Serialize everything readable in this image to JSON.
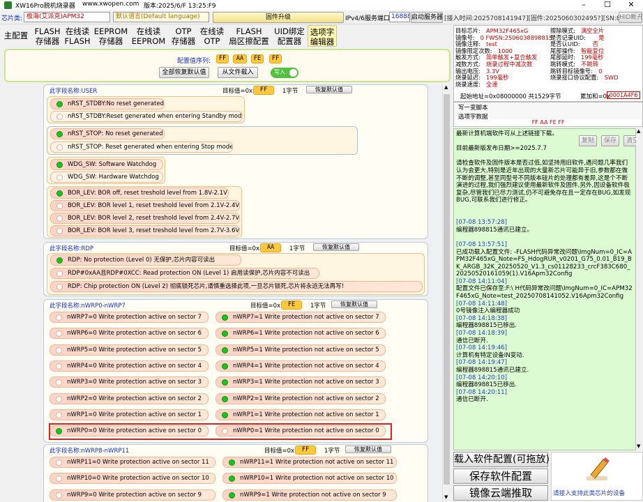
{
  "window": {
    "title": "XW16Pro脱机烧录器",
    "website": "www.xwopen.com",
    "version": "版本:2025/6/F 13:25:F9"
  },
  "topbar": {
    "chip_label": "芯片类:",
    "chip_value": "极海(艾派克)APM32",
    "lang_value": "默认语言(Default language)",
    "firmware_button": "固件升级",
    "port_label": "IPv4/6服务端口:",
    "port_value": "16888",
    "start_server": "启动服务器",
    "access_time": "[接入时间:2025708141947][固件:2025060302495?][SN:898815]",
    "hid_button": "HID断开"
  },
  "tabs": [
    {
      "l1": "主配置",
      "l2": ""
    },
    {
      "l1": "FLASH",
      "l2": "存储器"
    },
    {
      "l1": "在线读",
      "l2": "FLASH"
    },
    {
      "l1": "EEPROM",
      "l2": "存储器"
    },
    {
      "l1": "在线读",
      "l2": "EEPROM"
    },
    {
      "l1": "OTP",
      "l2": "存储器"
    },
    {
      "l1": "在线读",
      "l2": "OTP"
    },
    {
      "l1": "FLASH",
      "l2": "扇区擦配置"
    },
    {
      "l1": "UID绑定",
      "l2": "配置器"
    },
    {
      "l1": "选项字",
      "l2": "编辑器"
    }
  ],
  "config": {
    "seq_label": "配置值序列:",
    "seq_values": [
      "FF",
      "AA",
      "FE",
      "FF"
    ],
    "restore_all": "全部恢复默认值",
    "load_file": "从文件载入",
    "write_toggle": "写入"
  },
  "sections": {
    "user": {
      "name": "此字段名称:USER",
      "target_label": "目标值=0x",
      "target": "FF",
      "bytes": "1字节",
      "restore": "恢复默认值",
      "groups": [
        [
          "nRST_STDBY:No reset generated",
          "nRST_STDBY:Reset generated when entering Standby mode"
        ],
        [
          "nRST_STOP: No reset generated",
          "nRST_STOP: Reset generated when entering Stop mode"
        ],
        [
          "WDG_SW:   Software Watchdog",
          "WDG_SW:   Hardware Watchdog"
        ],
        [
          "BOR_LEV:   BOR off, reset treshold level from 1.8V-2.1V",
          "BOR_LEV:   BOR level 1, reset treshold level from 2.1V-2.4V",
          "BOR_LEV:   BOR level 2, reset treshold level from 2.4V-2.7V",
          "BOR_LEV:   BOR level 3, reset treshold level from 2.7V-3.6V"
        ]
      ]
    },
    "rdp": {
      "name": "此字段名称:RDP",
      "target_label": "目标值=0x",
      "target": "AA",
      "bytes": "1字节",
      "restore": "恢复默认值",
      "options": [
        "RDP:       No protection (Level 0)       无保护,芯片内容可读出",
        "RDP#0xAA且RDP#0XCC:   Read protection ON (Level 1)   启用读保护,芯片内容不可读出",
        "RDP:       Chip protection ON (Level 2)   彻底锁死芯片,请慎重选择此项,一旦芯片锁死,芯片将永远无法再写!"
      ]
    },
    "wrp0": {
      "name": "此字段名称:nWRP0-nWRP7",
      "target_label": "目标值=0x",
      "target": "FE",
      "bytes": "1字节",
      "restore": "恢复默认值",
      "left": [
        "nWRP7=0    Write protection active on sector  7",
        "nWRP6=0    Write protection active on sector  6",
        "nWRP5=0    Write protection active on sector  5",
        "nWRP4=0    Write protection active on sector  4",
        "nWRP3=0    Write protection active on sector  3",
        "nWRP2=0    Write protection active on sector  2",
        "nWRP1=0    Write protection active on sector  1",
        "nWRP0=0    Write protection active on sector  0"
      ],
      "right": [
        "nWRP7=1    Write protection not active on sector  7",
        "nWRP6=1    Write protection not active on sector  6",
        "nWRP5=1    Write protection not active on sector  5",
        "nWRP4=1    Write protection not active on sector  4",
        "nWRP3=1    Write protection not active on sector  3",
        "nWRP2=1    Write protection not active on sector  2",
        "nWRP1=1    Write protection not active on sector  1",
        "nWRP0=1    Write protection not active on sector  0"
      ]
    },
    "wrp8": {
      "name": "此字段名称:nWRP8-nWRP11",
      "target_label": "目标值=0x",
      "target": "FF",
      "bytes": "1字节",
      "restore": "恢复默认值",
      "left": [
        "nWRP11=0    Write protection active on sector  11",
        "nWRP10=0    Write protection active on sector  10",
        "nWRP9=0    Write protection active on sector  9"
      ],
      "right": [
        "nWRP11=1    Write protection not active on sector  11",
        "nWRP10=1    Write protection not active on sector  10",
        "nWRP9=1    Write protection not active on sector  9"
      ]
    }
  },
  "info": {
    "left": [
      [
        "目标芯片:",
        "APM32F465xG"
      ],
      [
        "镜像号:",
        "0 FWSN:2506038898815"
      ],
      [
        "镜像注释:",
        "test"
      ],
      [
        "镜像限定次数:",
        "1000"
      ],
      [
        "触发方式:",
        "简单触发+复合触发"
      ],
      [
        "减数方式:",
        "烧录过程中减次数"
      ],
      [
        "输出电压:",
        "3.3V"
      ],
      [
        "烧录延迟:",
        "199毫秒"
      ],
      [
        "烧录速度:",
        "全速"
      ]
    ],
    "right": [
      [
        "擦除模式:",
        "满空全片"
      ],
      [
        "是否记录UID:",
        "是"
      ],
      [
        "是否认UID:",
        "否"
      ],
      [
        "尾部操作:",
        "智能复位"
      ],
      [
        "尾部延时:",
        "199毫秒"
      ],
      [
        "跳转模式:",
        "不跳转"
      ],
      [
        "跳转目标镜像号:",
        "0"
      ],
      [
        "烧录接口协议配置:",
        "SWD"
      ]
    ],
    "addr_line": "起始地址=0x08000000  共1529字节",
    "sum_label": "累加和=0x",
    "sum_value": "0001A4F6"
  },
  "script": {
    "label": "写一变脚本",
    "option_label": "选项字数据",
    "option_value": "FF AA FE FF"
  },
  "log": {
    "buttons": [
      "复制",
      "保存",
      "清空"
    ],
    "lines": [
      {
        "t": "最新计算机端软件可从上述链接下载。",
        "ts": false
      },
      {
        "t": "",
        "ts": false
      },
      {
        "t": "目前最新版发布日期>=2025.7.7",
        "ts": false
      },
      {
        "t": "",
        "ts": false
      },
      {
        "t": "请检查软件及固件版本是否过低,如坚持用旧软件,遇问题几率我们认为会更大,特别是近年出现的大量新芯片可能异于旧,参数都在做不断的调整,甚至同型号不同版本硅片的处理都有差异,这是个不断演进的过程,我们强烈建议使用最新软件及固件,另外,因设备软件极复杂,尽管我们已尽力测试,仍不可避免存在且一定存在BUG,如发现BUG,可联系我们进行修正。",
        "ts": false
      },
      {
        "t": "",
        "ts": false
      },
      {
        "t": "",
        "ts": false
      },
      {
        "t": "[07-08 13:57:28]",
        "ts": true
      },
      {
        "t": "编程器898815通讯已建立。",
        "ts": false
      },
      {
        "t": "",
        "ts": false
      },
      {
        "t": "[07-08 13:57:51]",
        "ts": true
      },
      {
        "t": "已成功载入配置文件:                            -FLASH代码异常改问题\\ImgNum=0_IC=APM32F465xG_Note=FS_HdogRUR_v0201_G75_0.01_B19_BK_ARGB_32K_20250520_V1.3_cs01128233_crcF383C680_20250520161059(1).V16Apm32Config",
        "ts": false
      },
      {
        "t": "[07-08 14:11:04]",
        "ts": true
      },
      {
        "t": "配置文件已保存至:F:\\                                    H代码异常改问题\\ImgNum=0_IC=APM32F465xG_Note=test_20250708141052.V16Apm32Config",
        "ts": false
      },
      {
        "t": "[07-08 14:11:48]",
        "ts": true
      },
      {
        "t": "0号镜像注入编程器成功",
        "ts": false
      },
      {
        "t": "[07-08 14:18:38]",
        "ts": true
      },
      {
        "t": "编程器898815已移出.",
        "ts": false
      },
      {
        "t": "[07-08 14:18:39]",
        "ts": true
      },
      {
        "t": "通信已断开.",
        "ts": false
      },
      {
        "t": "[07-08 14:19:46]",
        "ts": true
      },
      {
        "t": "计算机有特定设备IN变动.",
        "ts": false
      },
      {
        "t": "[07-08 14:19:47]",
        "ts": true
      },
      {
        "t": "编程器898815通讯已建立.",
        "ts": false
      },
      {
        "t": "[07-08 14:20:10]",
        "ts": true
      },
      {
        "t": "编程器898815已移出.",
        "ts": false
      },
      {
        "t": "[07-08 14:20:11]",
        "ts": true
      },
      {
        "t": "通信已断开.",
        "ts": false
      }
    ]
  },
  "bottom": {
    "load": "载入软件配置(可拖放)",
    "save": "保存软件配置",
    "cloud": "镜像云端推取",
    "hint": "请接入支持此类芯片的设备"
  }
}
